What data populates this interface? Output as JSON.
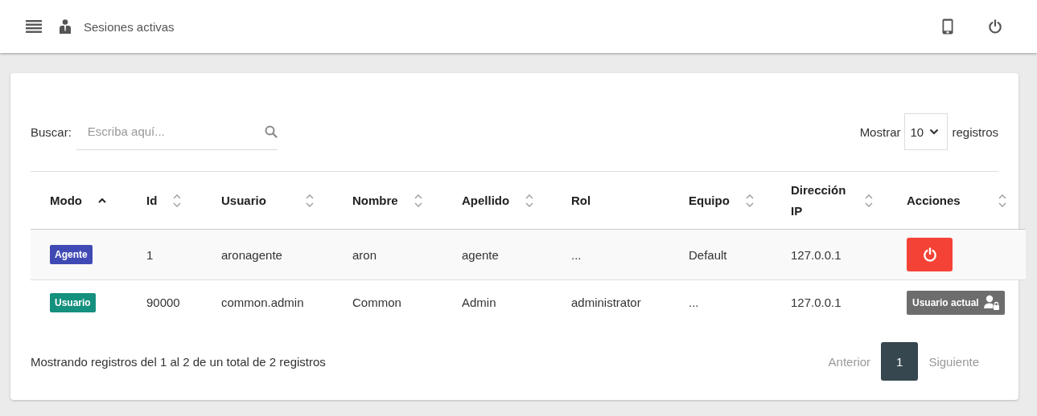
{
  "topbar": {
    "title": "Sesiones activas"
  },
  "search": {
    "label": "Buscar:",
    "placeholder": "Escriba aquí..."
  },
  "page_size": {
    "label_before": "Mostrar",
    "value": "10",
    "label_after": "registros"
  },
  "table": {
    "columns": [
      {
        "label": "Modo",
        "kind": "sorted_asc"
      },
      {
        "label": "Id",
        "kind": "sortable"
      },
      {
        "label": "Usuario",
        "kind": "sortable"
      },
      {
        "label": "Nombre",
        "kind": "sortable"
      },
      {
        "label": "Apellido",
        "kind": "sortable"
      },
      {
        "label": "Rol",
        "kind": "plain"
      },
      {
        "label": "Equipo",
        "kind": "sortable"
      },
      {
        "label": "Dirección IP",
        "kind": "sortable"
      },
      {
        "label": "Acciones",
        "kind": "sortable"
      }
    ],
    "rows": [
      {
        "highlighted": true,
        "cells": [
          {
            "kind": "badge",
            "text": "Agente",
            "color": "#3f4ab4"
          },
          {
            "kind": "text",
            "text": "1"
          },
          {
            "kind": "text",
            "text": "aronagente"
          },
          {
            "kind": "text",
            "text": "aron"
          },
          {
            "kind": "text",
            "text": "agente"
          },
          {
            "kind": "text",
            "text": "..."
          },
          {
            "kind": "text",
            "text": "Default"
          },
          {
            "kind": "text",
            "text": "127.0.0.1"
          },
          {
            "kind": "logout"
          }
        ]
      },
      {
        "highlighted": false,
        "cells": [
          {
            "kind": "badge",
            "text": "Usuario",
            "color": "#14907e"
          },
          {
            "kind": "text",
            "text": "90000"
          },
          {
            "kind": "text",
            "text": "common.admin"
          },
          {
            "kind": "text",
            "text": "Common"
          },
          {
            "kind": "text",
            "text": "Admin"
          },
          {
            "kind": "text",
            "text": "administrator"
          },
          {
            "kind": "text",
            "text": "..."
          },
          {
            "kind": "text",
            "text": "127.0.0.1"
          },
          {
            "kind": "current_user",
            "text": "Usuario actual"
          }
        ]
      }
    ]
  },
  "footer": {
    "info": "Mostrando registros del 1 al 2 de un total de 2 registros",
    "pagination": [
      {
        "label": "Anterior",
        "selected": false
      },
      {
        "label": "1",
        "selected": true
      },
      {
        "label": "Siguiente",
        "selected": false
      }
    ]
  }
}
